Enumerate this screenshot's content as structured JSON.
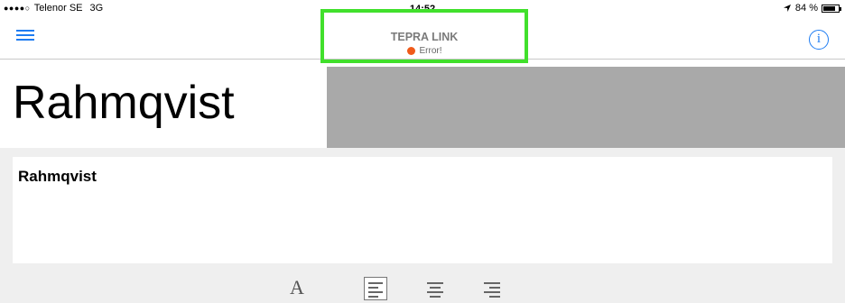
{
  "status_bar": {
    "signal": "●●●●○",
    "carrier": "Telenor SE",
    "network": "3G",
    "time": "14:52",
    "location_icon": "location-arrow-icon",
    "battery_text": "84 %",
    "battery_level": 0.84
  },
  "nav": {
    "menu_icon": "hamburger-menu-icon",
    "device_name": "TEPRA LINK",
    "device_status": "Error!",
    "status_color": "#f05a1a",
    "info_icon": "info-icon",
    "info_glyph": "i",
    "accent_color": "#1e7cf2"
  },
  "preview": {
    "label_text": "Rahmqvist"
  },
  "editor": {
    "text": "Rahmqvist"
  },
  "toolbar": {
    "font_glyph": "A",
    "font_icon": "font-icon",
    "align_left_icon": "align-left-icon",
    "align_center_icon": "align-center-icon",
    "align_right_icon": "align-right-icon",
    "selected_alignment": "left"
  }
}
